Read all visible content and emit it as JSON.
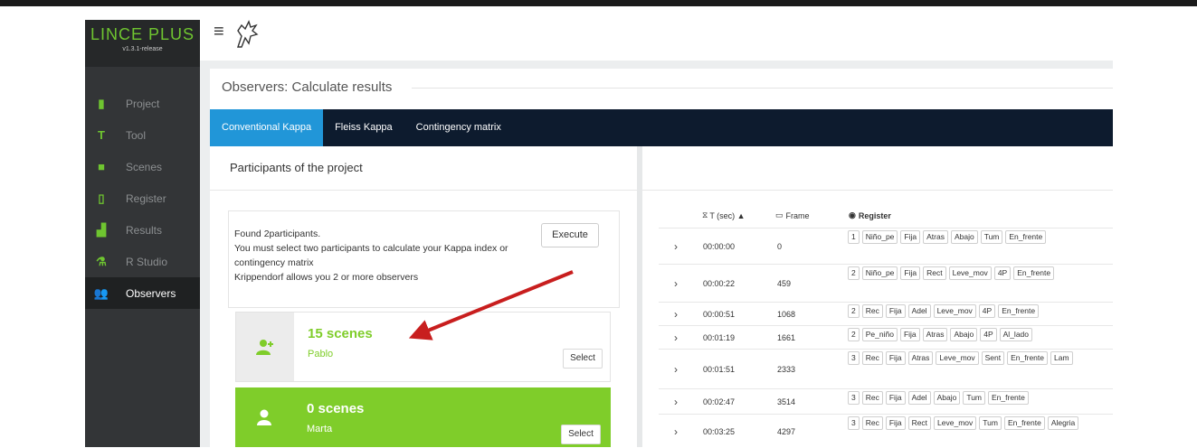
{
  "app": {
    "name": "LINCE PLUS",
    "version": "v1.3.1-release"
  },
  "sidebar": {
    "items": [
      {
        "label": "Project",
        "icon": "briefcase-icon",
        "glyph": "▮"
      },
      {
        "label": "Tool",
        "icon": "tool-icon",
        "glyph": "T"
      },
      {
        "label": "Scenes",
        "icon": "video-camera-icon",
        "glyph": "■"
      },
      {
        "label": "Register",
        "icon": "clipboard-icon",
        "glyph": "▯"
      },
      {
        "label": "Results",
        "icon": "bar-chart-icon",
        "glyph": "▟"
      },
      {
        "label": "R Studio",
        "icon": "flask-icon",
        "glyph": "⚗"
      },
      {
        "label": "Observers",
        "icon": "users-icon",
        "glyph": "👥",
        "active": true
      }
    ]
  },
  "page": {
    "title": "Observers: Calculate results"
  },
  "tabs": [
    {
      "label": "Conventional Kappa",
      "active": true
    },
    {
      "label": "Fleiss Kappa"
    },
    {
      "label": "Contingency matrix"
    }
  ],
  "participants": {
    "header": "Participants of the project",
    "info": [
      "Found 2participants.",
      "You must select two participants to calculate your Kappa index or",
      "contingency matrix",
      "Krippendorf allows you 2 or more observers"
    ],
    "execute_label": "Execute",
    "cards": [
      {
        "scenes": "15 scenes",
        "name": "Pablo",
        "select_label": "Select"
      },
      {
        "scenes": "0 scenes",
        "name": "Marta",
        "select_label": "Select"
      }
    ]
  },
  "table": {
    "columns": {
      "time": "T (sec) ▲",
      "frame": "Frame",
      "register": "Register"
    },
    "rows": [
      {
        "time": "00:00:00",
        "frame": "0",
        "tags": [
          "1",
          "Niño_pe",
          "Fija",
          "Atras",
          "Abajo",
          "Tum",
          "En_frente"
        ]
      },
      {
        "time": "00:00:22",
        "frame": "459",
        "tags": [
          "2",
          "Niño_pe",
          "Fija",
          "Rect",
          "Leve_mov",
          "4P",
          "En_frente"
        ]
      },
      {
        "time": "00:00:51",
        "frame": "1068",
        "tags": [
          "2",
          "Rec",
          "Fija",
          "Adel",
          "Leve_mov",
          "4P",
          "En_frente"
        ]
      },
      {
        "time": "00:01:19",
        "frame": "1661",
        "tags": [
          "2",
          "Pe_niño",
          "Fija",
          "Atras",
          "Abajo",
          "4P",
          "Al_lado"
        ]
      },
      {
        "time": "00:01:51",
        "frame": "2333",
        "tags": [
          "3",
          "Rec",
          "Fija",
          "Atras",
          "Leve_mov",
          "Sent",
          "En_frente",
          "Lam"
        ]
      },
      {
        "time": "00:02:47",
        "frame": "3514",
        "tags": [
          "3",
          "Rec",
          "Fija",
          "Adel",
          "Abajo",
          "Tum",
          "En_frente"
        ]
      },
      {
        "time": "00:03:25",
        "frame": "4297",
        "tags": [
          "3",
          "Rec",
          "Fija",
          "Rect",
          "Leve_mov",
          "Tum",
          "En_frente",
          "Alegria"
        ]
      }
    ]
  },
  "colors": {
    "accent": "#7fcd2a",
    "tab_active": "#2196d8",
    "tabbar": "#0d1b2e",
    "sidebar": "#333537",
    "arrow": "#c81e1e"
  }
}
